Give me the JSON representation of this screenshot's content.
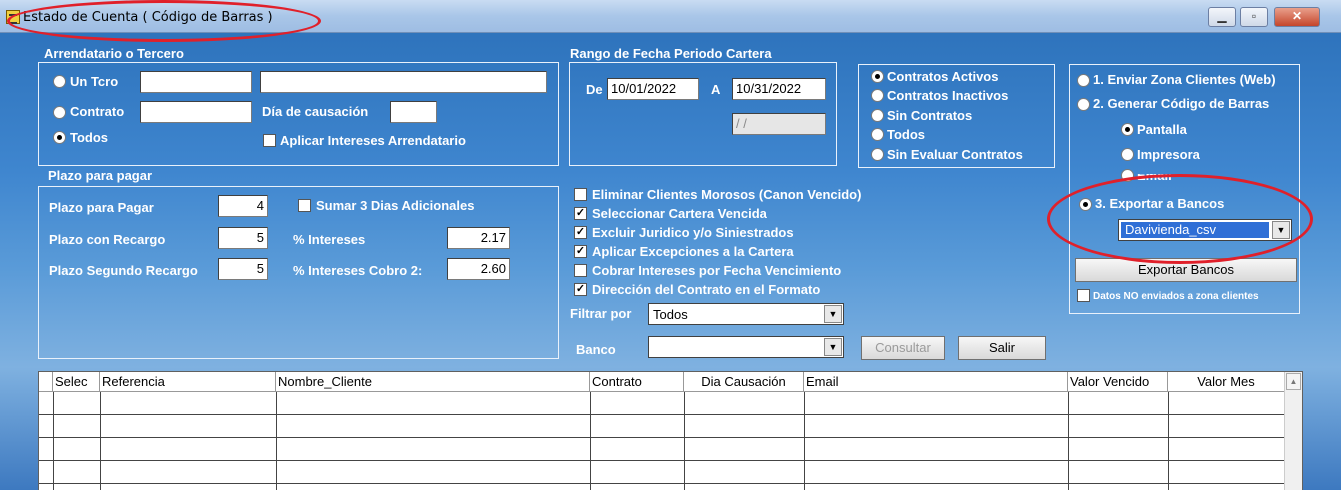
{
  "window": {
    "title": "Estado de Cuenta ( Código de Barras )",
    "controls": [
      "minimize",
      "maximize",
      "close"
    ]
  },
  "arrendatario": {
    "section_label": "Arrendatario o Tercero",
    "un_tcro_label": "Un Tcro",
    "contrato_label": "Contrato",
    "todos_label": "Todos",
    "selected": "Todos",
    "dia_causacion_label": "Día de causación",
    "aplicar_intereses_label": "Aplicar Intereses Arrendatario",
    "aplicar_intereses_checked": false
  },
  "plazo": {
    "section_label": "Plazo para pagar",
    "plazo_pagar_label": "Plazo para Pagar",
    "plazo_pagar_value": "4",
    "sumar_label": "Sumar 3 Dias Adicionales",
    "sumar_checked": false,
    "plazo_recargo_label": "Plazo con Recargo",
    "plazo_recargo_value": "5",
    "intereses_label": "% Intereses",
    "intereses_value": "2.17",
    "segundo_recargo_label": "Plazo Segundo Recargo",
    "segundo_recargo_value": "5",
    "intereses_cobro2_label": "% Intereses Cobro 2:",
    "intereses_cobro2_value": "2.60"
  },
  "rango": {
    "section_label": "Rango de Fecha Periodo Cartera",
    "de_label": "De",
    "de_value": "10/01/2022",
    "a_label": "A",
    "a_value": "10/31/2022",
    "extra_date": " / /"
  },
  "contratos": {
    "options": [
      "Contratos Activos",
      "Contratos Inactivos",
      "Sin Contratos",
      "Todos",
      "Sin Evaluar Contratos"
    ],
    "selected": "Contratos Activos"
  },
  "opciones": {
    "items": [
      {
        "label": "Eliminar Clientes Morosos (Canon Vencido)",
        "checked": false
      },
      {
        "label": "Seleccionar Cartera Vencida",
        "checked": true
      },
      {
        "label": "Excluir Juridico y/o Siniestrados",
        "checked": true
      },
      {
        "label": "Aplicar Excepciones a la Cartera",
        "checked": true
      },
      {
        "label": "Cobrar Intereses por Fecha Vencimiento",
        "checked": false
      },
      {
        "label": "Dirección del Contrato en el Formato",
        "checked": true
      }
    ]
  },
  "filtros": {
    "filtrar_label": "Filtrar por",
    "filtrar_value": "Todos",
    "banco_label": "Banco",
    "banco_value": "",
    "consultar_label": "Consultar",
    "salir_label": "Salir"
  },
  "acciones": {
    "opt1_label": "1. Enviar Zona Clientes (Web)",
    "opt2_label": "2. Generar Código de Barras",
    "pantalla_label": "Pantalla",
    "impresora_label": "Impresora",
    "email_label": "Email",
    "opt3_label": "3. Exportar a Bancos",
    "selected": "3. Exportar a Bancos",
    "sub_selected": "Pantalla",
    "banco_export_value": "Davivienda_csv",
    "exportar_label": "Exportar Bancos",
    "datos_no_enviados_label": "Datos NO enviados a zona clientes",
    "datos_no_enviados_checked": false
  },
  "grid": {
    "columns": [
      "Selec",
      "Referencia",
      "Nombre_Cliente",
      "Contrato",
      "Dia Causación",
      "Email",
      "Valor Vencido",
      "Valor Mes"
    ],
    "row_count": 5
  },
  "colors": {
    "annotation_ellipse": "#e0202a",
    "background": "#3f86cf"
  }
}
